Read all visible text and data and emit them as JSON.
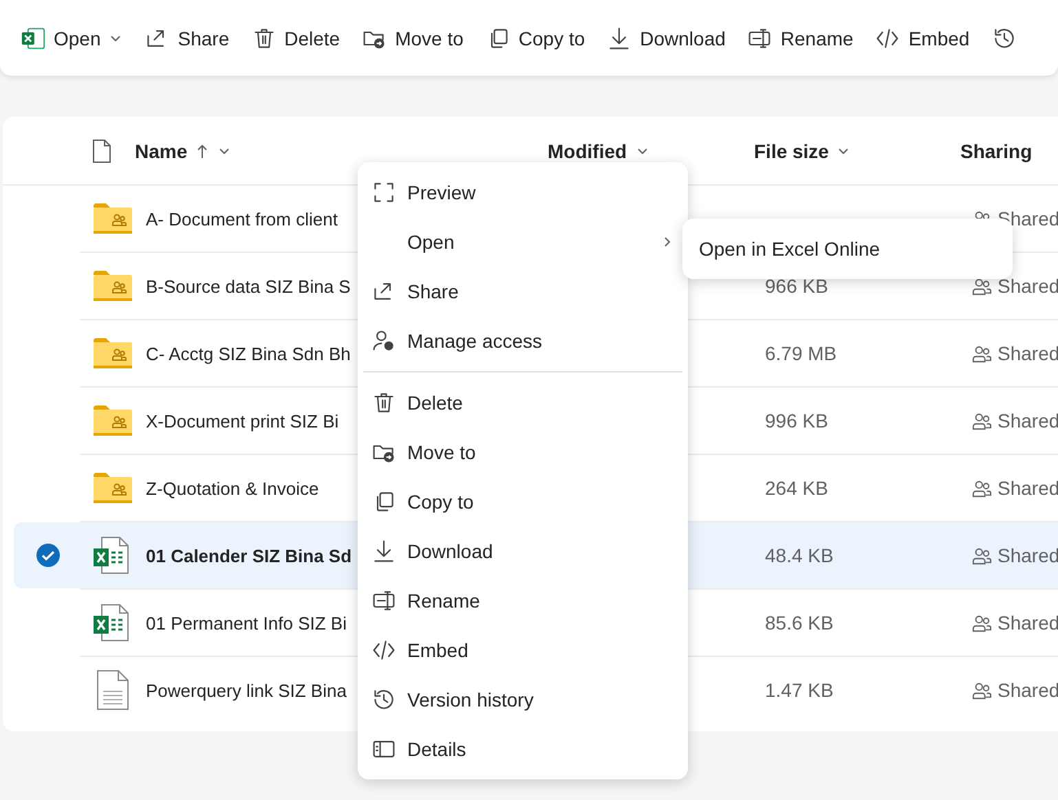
{
  "toolbar": [
    {
      "label": "Open",
      "dropdown": true
    },
    {
      "label": "Share"
    },
    {
      "label": "Delete"
    },
    {
      "label": "Move to"
    },
    {
      "label": "Copy to"
    },
    {
      "label": "Download"
    },
    {
      "label": "Rename"
    },
    {
      "label": "Embed"
    }
  ],
  "toolbar_history_button": true,
  "table": {
    "columns": [
      {
        "label": "Name",
        "sorted": true,
        "dropdown": true
      },
      {
        "label": "Modified",
        "sorted": false,
        "dropdown": true
      },
      {
        "label": "File size",
        "sorted": false,
        "dropdown": true
      },
      {
        "label": "Sharing",
        "sorted": false,
        "dropdown": false
      }
    ],
    "rows": [
      {
        "kind": "folder",
        "name": "A- Document from client",
        "sharing": "Shared",
        "selected": false
      },
      {
        "kind": "folder",
        "name": "B-Source data SIZ Bina S",
        "size": "966 KB",
        "sharing": "Shared",
        "selected": false
      },
      {
        "kind": "folder",
        "name": "C- Acctg SIZ Bina Sdn Bh",
        "size": "6.79 MB",
        "sharing": "Shared",
        "selected": false
      },
      {
        "kind": "folder",
        "name": "X-Document print SIZ Bi",
        "size": "996 KB",
        "sharing": "Shared",
        "selected": false
      },
      {
        "kind": "folder",
        "name": "Z-Quotation & Invoice",
        "size": "264 KB",
        "sharing": "Shared",
        "selected": false
      },
      {
        "kind": "excel",
        "name": "01 Calender SIZ Bina Sd",
        "size": "48.4 KB",
        "sharing": "Shared",
        "selected": true
      },
      {
        "kind": "excel",
        "name": "01 Permanent Info SIZ Bi",
        "size": "85.6 KB",
        "sharing": "Shared",
        "selected": false
      },
      {
        "kind": "text",
        "name": "Powerquery link SIZ Bina",
        "size": "1.47 KB",
        "sharing": "Shared",
        "selected": false
      }
    ]
  },
  "context_menu": {
    "groups": [
      [
        {
          "label": "Preview",
          "submenu": false
        },
        {
          "label": "Open",
          "submenu": true
        },
        {
          "label": "Share",
          "submenu": false
        },
        {
          "label": "Manage access",
          "submenu": false
        }
      ],
      [
        {
          "label": "Delete",
          "submenu": false
        },
        {
          "label": "Move to",
          "submenu": false
        },
        {
          "label": "Copy to",
          "submenu": false
        },
        {
          "label": "Download",
          "submenu": false
        },
        {
          "label": "Rename",
          "submenu": false
        },
        {
          "label": "Embed",
          "submenu": false
        },
        {
          "label": "Version history",
          "submenu": false
        },
        {
          "label": "Details",
          "submenu": false
        }
      ]
    ]
  },
  "submenu": {
    "items": [
      "Open in Excel Online"
    ]
  }
}
